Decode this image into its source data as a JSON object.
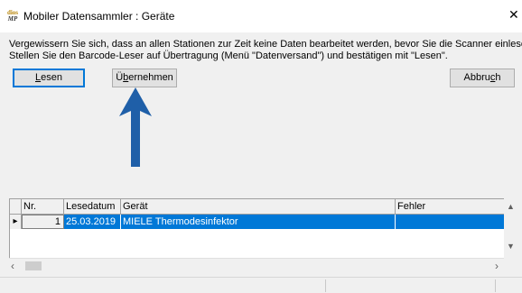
{
  "window": {
    "logo_top": "dios",
    "logo_bottom": "MP",
    "title": "Mobiler Datensammler : Geräte",
    "close_glyph": "✕"
  },
  "message": {
    "line1": "Vergewissern Sie sich, dass an allen Stationen zur Zeit keine Daten bearbeitet werden, bevor Sie die Scanner einlesen.",
    "line2": "Stellen Sie den Barcode-Leser auf Übertragung (Menü \"Datenversand\") und bestätigen mit \"Lesen\"."
  },
  "buttons": {
    "lesen_access": "L",
    "lesen_rest": "esen",
    "uebernehmen_first": "Ü",
    "uebernehmen_access": "b",
    "uebernehmen_rest": "ernehmen",
    "abbruch_first": "Abbru",
    "abbruch_access": "c",
    "abbruch_rest": "h"
  },
  "annotation": {
    "arrow_color": "#1f5fa8"
  },
  "table": {
    "columns": [
      "Nr.",
      "Lesedatum",
      "Gerät",
      "Fehler"
    ],
    "rows": [
      {
        "indicator": "▸",
        "nr": "1",
        "lesedatum": "25.03.2019",
        "geraet": "MIELE Thermodesinfektor",
        "fehler": ""
      }
    ],
    "selection_color": "#0078d7"
  },
  "scrollbars": {
    "up": "▲",
    "down": "▼",
    "left": "‹",
    "right": "›"
  }
}
